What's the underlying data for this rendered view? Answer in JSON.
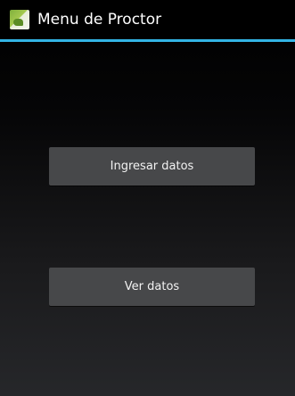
{
  "action_bar": {
    "title": "Menu de Proctor",
    "icon": "app-launcher-icon",
    "divider_color": "#33b5e5"
  },
  "main": {
    "buttons": [
      {
        "label": "Ingresar datos"
      },
      {
        "label": "Ver datos"
      }
    ]
  }
}
